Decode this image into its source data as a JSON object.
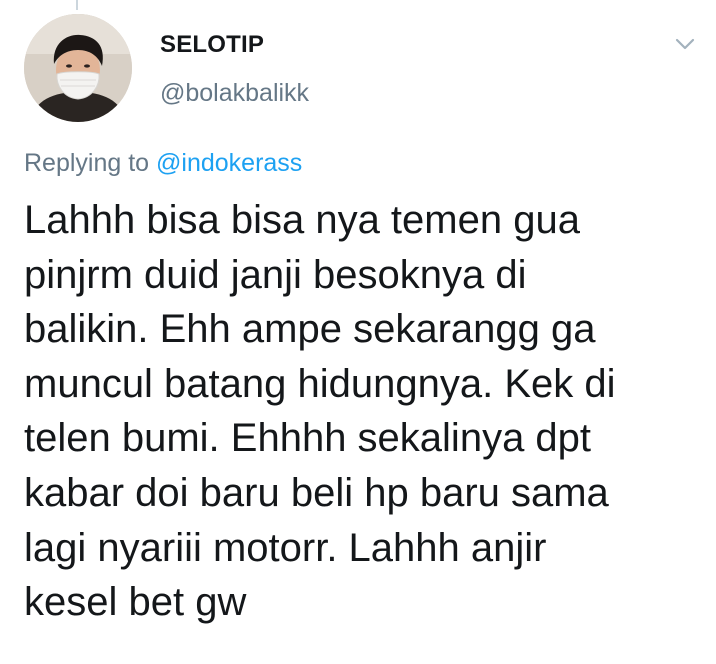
{
  "tweet": {
    "author": {
      "display_name": "SELOTIP",
      "handle": "@bolakbalikk"
    },
    "reply": {
      "prefix": "Replying to",
      "mention": "@indokerass"
    },
    "text": "Lahhh bisa bisa nya temen gua\npinjrm duid janji besoknya di\nbalikin. Ehh ampe sekarangg ga\nmuncul batang hidungnya. Kek di\ntelen bumi. Ehhhh sekalinya dpt\nkabar doi baru beli hp baru sama\nlagi nyariii motorr. Lahhh anjir\nkesel bet gw"
  },
  "icons": {
    "menu": "chevron-down-icon",
    "avatar": "avatar-masked-person"
  },
  "colors": {
    "text_primary": "#14171a",
    "text_secondary": "#657786",
    "link": "#1da1f2",
    "chevron": "#a3b2bd"
  }
}
